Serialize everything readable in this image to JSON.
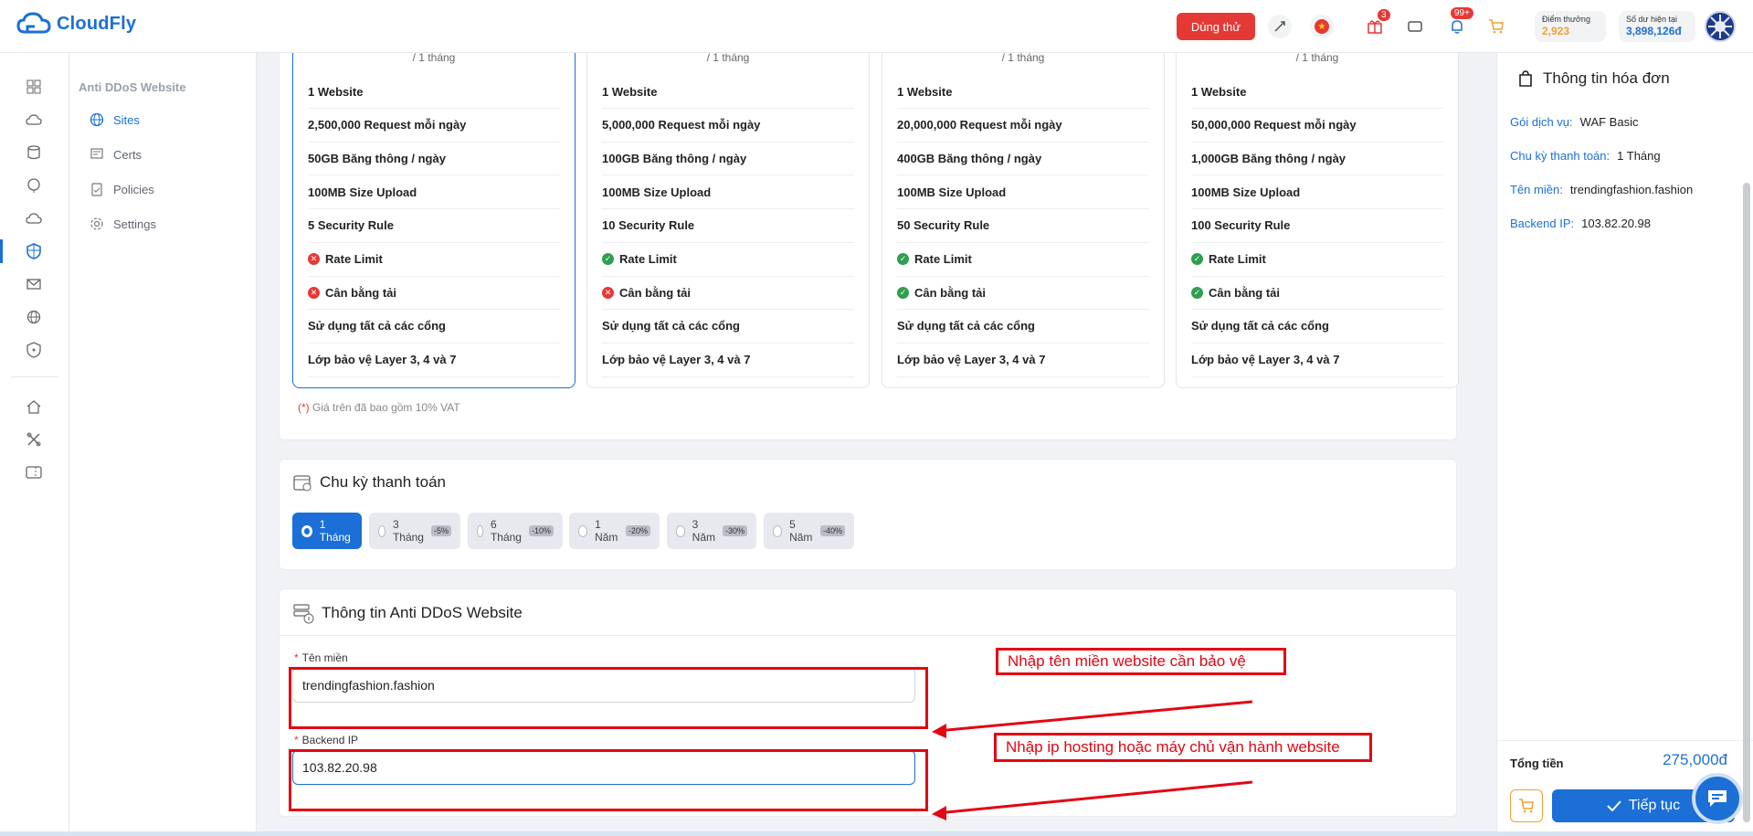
{
  "app": {
    "name": "CloudFly"
  },
  "topbar": {
    "trial_label": "Dùng thử",
    "gift_badge": "3",
    "bell_badge": "99+",
    "points_label": "Điểm thưởng",
    "points_value": "2,923",
    "balance_label": "Số dư hiện tại",
    "balance_value": "3,898,126đ"
  },
  "subnav": {
    "title": "Anti DDoS Website",
    "items": [
      {
        "label": "Sites"
      },
      {
        "label": "Certs"
      },
      {
        "label": "Policies"
      },
      {
        "label": "Settings"
      }
    ]
  },
  "plans": [
    {
      "price": "/ 1 tháng",
      "features": [
        {
          "text": "1 Website"
        },
        {
          "text": "2,500,000 Request mỗi ngày"
        },
        {
          "text": "50GB Băng thông / ngày"
        },
        {
          "text": "100MB Size Upload"
        },
        {
          "text": "5 Security Rule"
        },
        {
          "text": "Rate Limit",
          "status": "no"
        },
        {
          "text": "Cân bằng tải",
          "status": "no"
        },
        {
          "text": "Sử dụng tất cả các cổng"
        },
        {
          "text": "Lớp bảo vệ Layer 3, 4 và 7"
        }
      ]
    },
    {
      "price": "/ 1 tháng",
      "features": [
        {
          "text": "1 Website"
        },
        {
          "text": "5,000,000 Request mỗi ngày"
        },
        {
          "text": "100GB Băng thông / ngày"
        },
        {
          "text": "100MB Size Upload"
        },
        {
          "text": "10 Security Rule"
        },
        {
          "text": "Rate Limit",
          "status": "ok"
        },
        {
          "text": "Cân bằng tải",
          "status": "no"
        },
        {
          "text": "Sử dụng tất cả các cổng"
        },
        {
          "text": "Lớp bảo vệ Layer 3, 4 và 7"
        }
      ]
    },
    {
      "price": "/ 1 tháng",
      "features": [
        {
          "text": "1 Website"
        },
        {
          "text": "20,000,000 Request mỗi ngày"
        },
        {
          "text": "400GB Băng thông / ngày"
        },
        {
          "text": "100MB Size Upload"
        },
        {
          "text": "50 Security Rule"
        },
        {
          "text": "Rate Limit",
          "status": "ok"
        },
        {
          "text": "Cân bằng tải",
          "status": "ok"
        },
        {
          "text": "Sử dụng tất cả các cổng"
        },
        {
          "text": "Lớp bảo vệ Layer 3, 4 và 7"
        }
      ]
    },
    {
      "price": "/ 1 tháng",
      "features": [
        {
          "text": "1 Website"
        },
        {
          "text": "50,000,000 Request mỗi ngày"
        },
        {
          "text": "1,000GB Băng thông / ngày"
        },
        {
          "text": "100MB Size Upload"
        },
        {
          "text": "100 Security Rule"
        },
        {
          "text": "Rate Limit",
          "status": "ok"
        },
        {
          "text": "Cân bằng tải",
          "status": "ok"
        },
        {
          "text": "Sử dụng tất cả các cổng"
        },
        {
          "text": "Lớp bảo vệ Layer 3, 4 và 7"
        }
      ]
    }
  ],
  "vat_note_mark": "(*)",
  "vat_note": "Giá trên đã bao gồm 10% VAT",
  "cycle": {
    "title": "Chu kỳ thanh toán",
    "options": [
      {
        "label": "1 Tháng",
        "discount": "",
        "selected": true
      },
      {
        "label": "3 Tháng",
        "discount": "-5%"
      },
      {
        "label": "6 Tháng",
        "discount": "-10%"
      },
      {
        "label": "1 Năm",
        "discount": "-20%"
      },
      {
        "label": "3 Năm",
        "discount": "-30%"
      },
      {
        "label": "5 Năm",
        "discount": "-40%"
      }
    ]
  },
  "info": {
    "title": "Thông tin Anti DDoS Website",
    "domain_label": "Tên miền",
    "domain_value": "trendingfashion.fashion",
    "ip_label": "Backend IP",
    "ip_value": "103.82.20.98"
  },
  "annotations": {
    "domain": "Nhập tên miền website cần bảo vệ",
    "ip": "Nhập ip hosting hoặc máy chủ vận hành website"
  },
  "invoice": {
    "title": "Thông tin hóa đơn",
    "rows": [
      {
        "k": "Gói dịch vụ:",
        "v": "WAF Basic"
      },
      {
        "k": "Chu kỳ thanh toán:",
        "v": "1 Tháng"
      },
      {
        "k": "Tên miền:",
        "v": "trendingfashion.fashion"
      },
      {
        "k": "Backend IP:",
        "v": "103.82.20.98"
      }
    ],
    "total_label": "Tổng tiền",
    "total_value": "275,000đ",
    "next_label": "Tiếp tục"
  },
  "colors": {
    "accent": "#1b6fd6",
    "danger": "#e53935",
    "success": "#2e9f4f",
    "annotation": "#e30613"
  }
}
